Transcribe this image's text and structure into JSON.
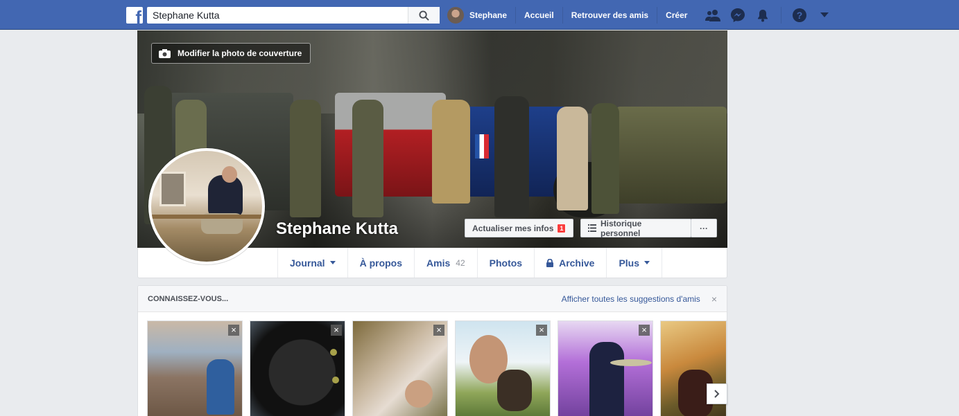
{
  "topbar": {
    "search_value": "Stephane Kutta",
    "user_name": "Stephane",
    "nav": [
      "Accueil",
      "Retrouver des amis",
      "Créer"
    ],
    "colors": {
      "bar": "#4267b2"
    }
  },
  "cover": {
    "edit_label": "Modifier la photo de couverture",
    "profile_name": "Stephane Kutta",
    "update_info_label": "Actualiser mes infos",
    "update_info_badge": "1",
    "activity_log_label": "Historique personnel",
    "more_label": "···"
  },
  "tabs": {
    "timeline": "Journal",
    "about": "À propos",
    "friends": "Amis",
    "friends_count": "42",
    "photos": "Photos",
    "archive": "Archive",
    "more": "Plus"
  },
  "suggestions": {
    "title": "CONNAISSEZ-VOUS...",
    "see_all": "Afficher toutes les suggestions d'amis",
    "close": "×"
  }
}
